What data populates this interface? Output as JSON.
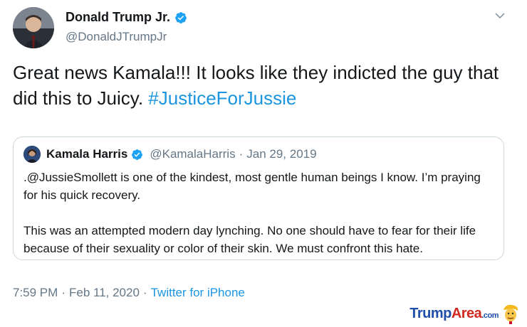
{
  "tweet": {
    "author_name": "Donald Trump Jr.",
    "author_handle": "@DonaldJTrumpJr",
    "text_main": "Great news Kamala!!! It looks like they indicted the guy that did this to Juicy.",
    "hashtag": "#JusticeForJussie",
    "time": "7:59 PM",
    "date": "Feb 11, 2020",
    "separator": "·",
    "source": "Twitter for iPhone"
  },
  "quoted": {
    "author_name": "Kamala Harris",
    "author_handle": "@KamalaHarris",
    "separator": "·",
    "date": "Jan 29, 2019",
    "paragraph1": ".@JussieSmollett is one of the kindest, most gentle human beings I know. I’m praying for his quick recovery.",
    "paragraph2": "This was an attempted modern day lynching. No one should have to fear for their life because of their sexuality or color of their skin. We must confront this hate."
  },
  "watermark": {
    "part1": "Trump",
    "part2": "Area",
    "suffix": ".com"
  },
  "colors": {
    "link": "#1b95e0",
    "verified": "#1da1f2",
    "secondary_text": "#657786",
    "border": "#ccd6dd"
  }
}
